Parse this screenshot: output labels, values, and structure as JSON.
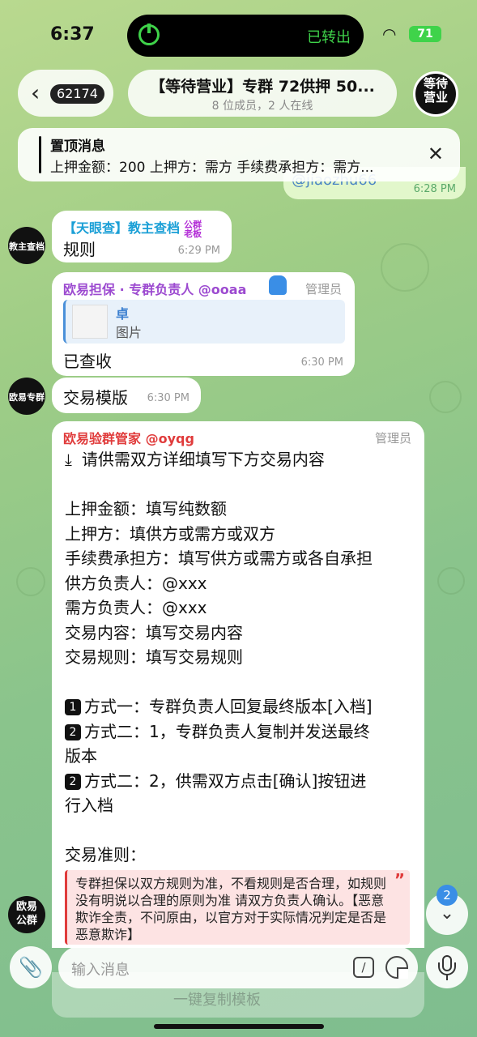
{
  "status": {
    "time": "6:37",
    "island_text": "已转出",
    "battery": "71"
  },
  "header": {
    "back_count": "62174",
    "title": "【等待营业】专群 72供押 50...",
    "subtitle": "8 位成员，2 人在线",
    "avatar_text_line1": "等待",
    "avatar_text_line2": "营业"
  },
  "pinned": {
    "title": "置顶消息",
    "text": "上押金额：200 上押方：需方 手续费承担方：需方..."
  },
  "outgoing_partial": {
    "text": "@jiaozhu66",
    "time": "6:28 PM"
  },
  "messages": {
    "m1": {
      "sender": "【天眼查】教主查档",
      "tag_line1": "公群",
      "tag_line2": "老板",
      "text": "规则",
      "time": "6:29 PM",
      "avatar_text": "教主查档"
    },
    "m2": {
      "sender": "欧易担保 · 专群负责人 @ooaa",
      "role": "管理员",
      "reply_title": "卓",
      "reply_sub": "图片",
      "text": "已查收",
      "time": "6:30 PM"
    },
    "m3": {
      "text": "交易模版",
      "time": "6:30 PM",
      "avatar_text": "欧易专群"
    },
    "m4": {
      "sender": "欧易验群管家 @oyqg",
      "role": "管理员",
      "avatar_text_line1": "欧易",
      "avatar_text_line2": "公群",
      "heading": "请供需双方详细填写下方交易内容",
      "fields": [
        "上押金额：填写纯数额",
        "上押方：填供方或需方或双方",
        "手续费承担方：填写供方或需方或各自承担",
        "供方负责人：@xxx",
        "需方负责人：@xxx",
        "交易内容：填写交易内容",
        "交易规则：填写交易规则"
      ],
      "method1_num": "1",
      "method1": "方式一：专群负责人回复最终版本[入档]",
      "method2a_num": "2",
      "method2a_line1": "方式二：1，专群负责人复制并发送最终",
      "method2a_line2": "版本",
      "method2b_num": "2",
      "method2b_line1": "方式二：2，供需双方点击[确认]按钮进",
      "method2b_line2": "行入档",
      "rules_title": "交易准则：",
      "quote": "专群担保以双方规则为准，不看规则是否合理，如规则没有明说以合理的原则为准 请双方负责人确认。【恶意欺诈全责，不问原由，以官方对于实际情况判定是否是恶意欺诈】"
    }
  },
  "scroll": {
    "unread": "2"
  },
  "input": {
    "placeholder": "输入消息",
    "ghost_button": "一键复制模板"
  }
}
